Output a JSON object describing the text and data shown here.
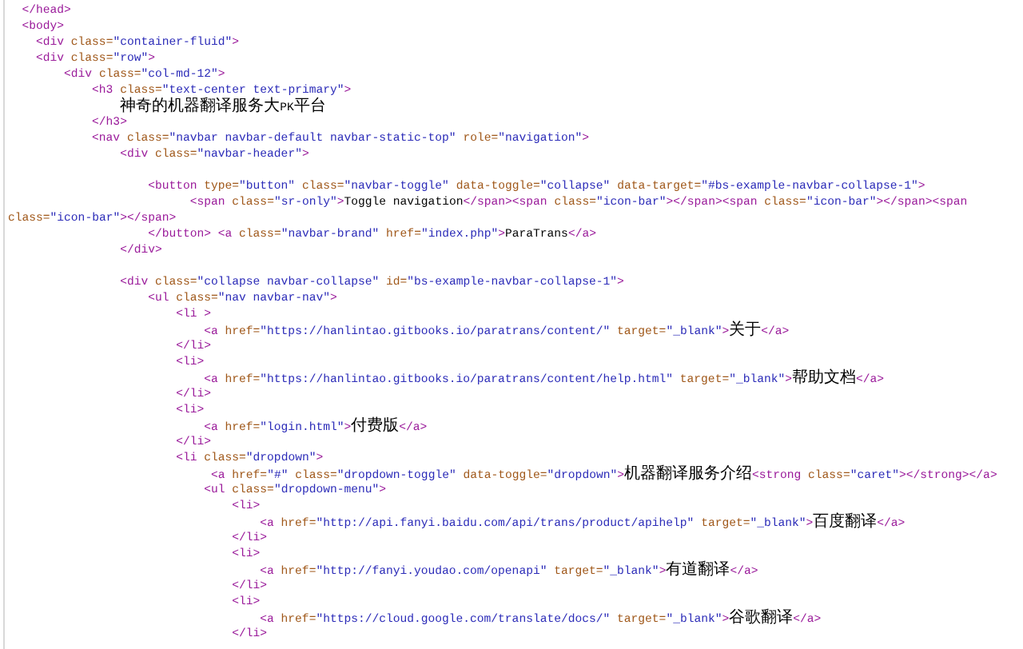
{
  "code_lines": [
    {
      "kind": "code",
      "text": "  </head>"
    },
    {
      "kind": "code",
      "text": "  <body>"
    },
    {
      "kind": "code",
      "text": "    <div class=\"container-fluid\">"
    },
    {
      "kind": "code",
      "text": "    <div class=\"row\">"
    },
    {
      "kind": "code",
      "text": "        <div class=\"col-md-12\">"
    },
    {
      "kind": "code",
      "text": "            <h3 class=\"text-center text-primary\">"
    },
    {
      "kind": "code",
      "text": "                神奇的机器翻译服务大PK平台"
    },
    {
      "kind": "code",
      "text": "            </h3>"
    },
    {
      "kind": "code",
      "text": "            <nav class=\"navbar navbar-default navbar-static-top\" role=\"navigation\">"
    },
    {
      "kind": "code",
      "text": "                <div class=\"navbar-header\">"
    },
    {
      "kind": "blank"
    },
    {
      "kind": "code",
      "text": "                    <button type=\"button\" class=\"navbar-toggle\" data-toggle=\"collapse\" data-target=\"#bs-example-navbar-collapse-1\">"
    },
    {
      "kind": "code",
      "text": "                          <span class=\"sr-only\">Toggle navigation</span><span class=\"icon-bar\"></span><span class=\"icon-bar\"></span><span"
    },
    {
      "kind": "code",
      "text": "class=\"icon-bar\"></span>"
    },
    {
      "kind": "code",
      "text": "                    </button> <a class=\"navbar-brand\" href=\"index.php\">ParaTrans</a>"
    },
    {
      "kind": "code",
      "text": "                </div>"
    },
    {
      "kind": "blank"
    },
    {
      "kind": "code",
      "text": "                <div class=\"collapse navbar-collapse\" id=\"bs-example-navbar-collapse-1\">"
    },
    {
      "kind": "code",
      "text": "                    <ul class=\"nav navbar-nav\">"
    },
    {
      "kind": "code",
      "text": "                        <li >"
    },
    {
      "kind": "code",
      "text": "                            <a href=\"https://hanlintao.gitbooks.io/paratrans/content/\" target=\"_blank\">关于</a>"
    },
    {
      "kind": "code",
      "text": "                        </li>"
    },
    {
      "kind": "code",
      "text": "                        <li>"
    },
    {
      "kind": "code",
      "text": "                            <a href=\"https://hanlintao.gitbooks.io/paratrans/content/help.html\" target=\"_blank\">帮助文档</a>"
    },
    {
      "kind": "code",
      "text": "                        </li>"
    },
    {
      "kind": "code",
      "text": "                        <li>"
    },
    {
      "kind": "code",
      "text": "                            <a href=\"login.html\">付费版</a>"
    },
    {
      "kind": "code",
      "text": "                        </li>"
    },
    {
      "kind": "code",
      "text": "                        <li class=\"dropdown\">"
    },
    {
      "kind": "code",
      "text": "                             <a href=\"#\" class=\"dropdown-toggle\" data-toggle=\"dropdown\">机器翻译服务介绍<strong class=\"caret\"></strong></a>"
    },
    {
      "kind": "code",
      "text": "                            <ul class=\"dropdown-menu\">"
    },
    {
      "kind": "code",
      "text": "                                <li>"
    },
    {
      "kind": "code",
      "text": "                                    <a href=\"http://api.fanyi.baidu.com/api/trans/product/apihelp\" target=\"_blank\">百度翻译</a>"
    },
    {
      "kind": "code",
      "text": "                                </li>"
    },
    {
      "kind": "code",
      "text": "                                <li>"
    },
    {
      "kind": "code",
      "text": "                                    <a href=\"http://fanyi.youdao.com/openapi\" target=\"_blank\">有道翻译</a>"
    },
    {
      "kind": "code",
      "text": "                                </li>"
    },
    {
      "kind": "code",
      "text": "                                <li>"
    },
    {
      "kind": "code",
      "text": "                                    <a href=\"https://cloud.google.com/translate/docs/\" target=\"_blank\">谷歌翻译</a>"
    },
    {
      "kind": "code",
      "text": "                                </li>"
    }
  ]
}
